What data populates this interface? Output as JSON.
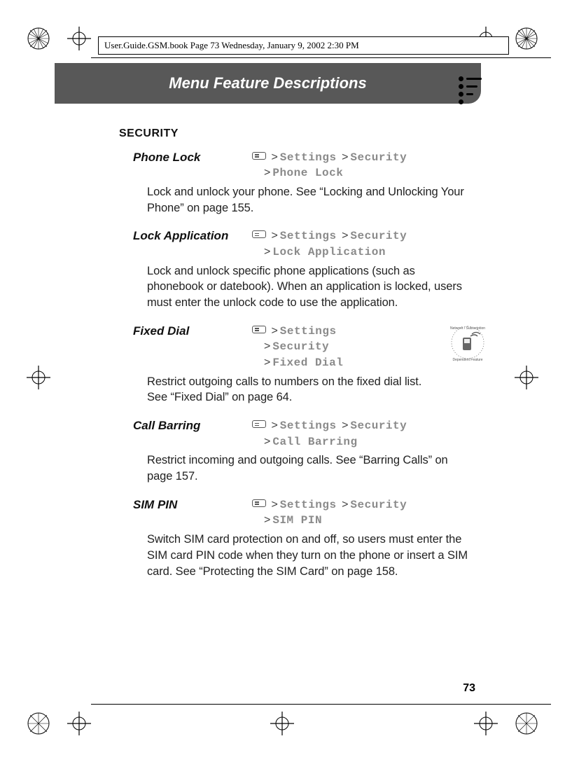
{
  "meta": {
    "header_text": "User.Guide.GSM.book  Page 73  Wednesday, January 9, 2002  2:30 PM"
  },
  "chapter": {
    "title": "Menu Feature Descriptions"
  },
  "section": {
    "heading": "SECURITY"
  },
  "features": [
    {
      "name": "Phone Lock",
      "path": [
        "Settings",
        "Security",
        "Phone Lock"
      ],
      "desc": "Lock and unlock your phone. See “Locking and Unlocking Your Phone” on page 155."
    },
    {
      "name": "Lock Application",
      "path": [
        "Settings",
        "Security",
        "Lock Application"
      ],
      "desc": "Lock and unlock specific phone applications (such as phonebook or datebook). When an application is locked, users must enter the unlock code to use the application."
    },
    {
      "name": "Fixed Dial",
      "path": [
        "Settings",
        "Security",
        "Fixed Dial"
      ],
      "desc": "Restrict outgoing calls to numbers on the fixed dial list. See “Fixed Dial” on page 64.",
      "network_dependent": true
    },
    {
      "name": "Call Barring",
      "path": [
        "Settings",
        "Security",
        "Call Barring"
      ],
      "desc": "Restrict incoming and outgoing calls. See “Barring Calls” on page 157."
    },
    {
      "name": "SIM PIN",
      "path": [
        "Settings",
        "Security",
        "SIM PIN"
      ],
      "desc": "Switch SIM card protection on and off, so users must enter the SIM card PIN code when they turn on the phone or insert a SIM card. See “Protecting the SIM Card” on page 158."
    }
  ],
  "page_number": "73"
}
